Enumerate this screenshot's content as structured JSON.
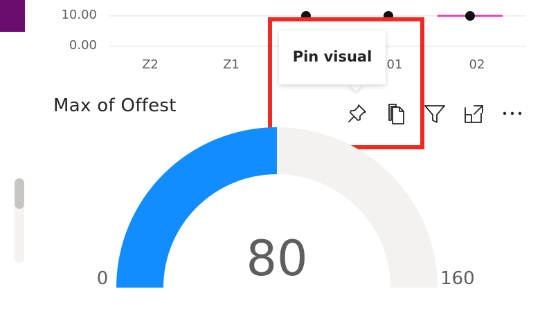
{
  "top_chart": {
    "y_ticks": [
      "10.00",
      "0.00"
    ],
    "x_ticks": [
      "Z2",
      "Z1",
      "01",
      "02"
    ],
    "line_color": "#e044a7",
    "point_color": "#111111"
  },
  "tooltip": {
    "text": "Pin visual"
  },
  "visual": {
    "title": "Max of Offest",
    "icons": [
      "pin-icon",
      "copy-icon",
      "filter-icon",
      "focus-mode-icon",
      "more-options-icon"
    ]
  },
  "gauge": {
    "value": "80",
    "min": "0",
    "max": "160",
    "value_num": 80,
    "min_num": 0,
    "max_num": 160,
    "fill_color": "#118dff",
    "track_color": "#f3f2f1"
  },
  "colors": {
    "highlight": "#ee2a24",
    "header_bar": "#6a0d6f"
  }
}
